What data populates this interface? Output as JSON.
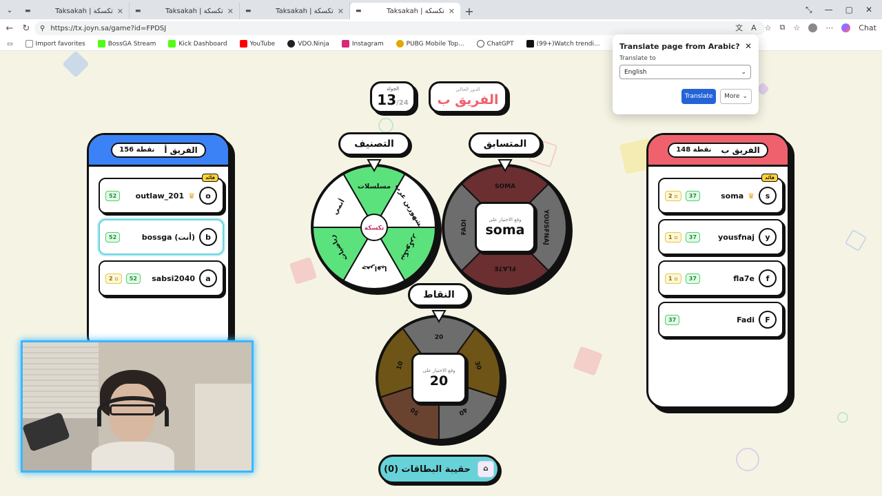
{
  "browser": {
    "tabs": [
      {
        "title": "Taksakah | تكسكة",
        "active": false
      },
      {
        "title": "Taksakah | تكسكة",
        "active": false
      },
      {
        "title": "Taksakah | تكسكة",
        "active": false
      },
      {
        "title": "Taksakah | تكسكة",
        "active": true
      }
    ],
    "url": "https://tx.joyn.sa/game?id=FPDSJ",
    "chat_label": "Chat",
    "bookmarks": [
      "Import favorites",
      "BossGA Stream",
      "Kick Dashboard",
      "YouTube",
      "VDO.Ninja",
      "Instagram",
      "PUBG Mobile Top...",
      "ChatGPT",
      "(99+)Watch trendi..."
    ]
  },
  "translate_popup": {
    "title": "Translate page from Arabic?",
    "label": "Translate to",
    "selected": "English",
    "translate_btn": "Translate",
    "more_btn": "More"
  },
  "game": {
    "round": {
      "label": "الجولة",
      "current": "13",
      "total": "/24"
    },
    "current_turn": {
      "label": "الدور الحالي",
      "team": "الفريق ب"
    },
    "team_a": {
      "name": "الفريق أ",
      "points_label": "156 نقطة",
      "color": "#3b82f6",
      "players": [
        {
          "initial": "o",
          "name": "outlaw_201",
          "score": "52",
          "cards": "",
          "leader": "قائد",
          "crown": true,
          "me": false
        },
        {
          "initial": "b",
          "name": "bossga (أنت)",
          "score": "52",
          "cards": "",
          "leader": "",
          "crown": false,
          "me": true
        },
        {
          "initial": "a",
          "name": "sabsi2040",
          "score": "52",
          "cards": "2",
          "leader": "",
          "crown": false,
          "me": false
        }
      ]
    },
    "team_b": {
      "name": "الفريق ب",
      "points_label": "148 نقطة",
      "color": "#f0616e",
      "players": [
        {
          "initial": "s",
          "name": "soma",
          "score": "37",
          "cards": "2",
          "leader": "قائد",
          "crown": true
        },
        {
          "initial": "y",
          "name": "yousfnaj",
          "score": "37",
          "cards": "1",
          "leader": "",
          "crown": false
        },
        {
          "initial": "f",
          "name": "fla7e",
          "score": "37",
          "cards": "1",
          "leader": "",
          "crown": false
        },
        {
          "initial": "F",
          "name": "Fadi",
          "score": "37",
          "cards": "",
          "leader": "",
          "crown": false
        }
      ]
    },
    "category_wheel": {
      "title": "التصنيف",
      "segments": [
        "مسلسلات",
        "مشهورين عرب",
        "تيكتوكرز",
        "جغرافيا",
        "رياضيات",
        "أنمي"
      ],
      "logo": "تكسكة"
    },
    "player_wheel": {
      "title": "المتسابق",
      "segments": [
        "SOMA",
        "YOUSFNAJ",
        "FLA7E",
        "FADI"
      ],
      "result_label": "وقع الاختيار على",
      "result": "soma"
    },
    "points_wheel": {
      "title": "النقاط",
      "segments": [
        "20",
        "30",
        "40",
        "50",
        "10"
      ],
      "result_label": "وقع الاختيار على",
      "result": "20"
    },
    "card_bag": {
      "label": "حقيبة البطاقات (0)"
    }
  }
}
